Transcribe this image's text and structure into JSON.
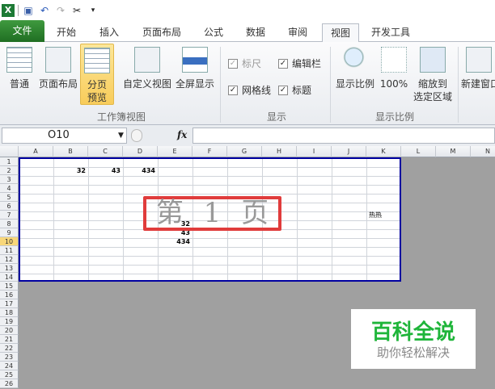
{
  "qat": {
    "icons": [
      "excel-logo-icon",
      "save-icon",
      "undo-icon",
      "redo-icon",
      "tools-icon",
      "customize-icon"
    ]
  },
  "tabs": [
    "文件",
    "开始",
    "插入",
    "页面布局",
    "公式",
    "数据",
    "审阅",
    "视图",
    "开发工具"
  ],
  "active_tab": "视图",
  "ribbon": {
    "workbook_views": {
      "label": "工作簿视图",
      "buttons": [
        "普通",
        "页面布局",
        "分页\n预览",
        "自定义视图",
        "全屏显示"
      ],
      "active": "分页预览"
    },
    "show": {
      "label": "显示",
      "checks": [
        {
          "label": "标尺",
          "checked": true,
          "disabled": true
        },
        {
          "label": "编辑栏",
          "checked": true
        },
        {
          "label": "网格线",
          "checked": true
        },
        {
          "label": "标题",
          "checked": true
        }
      ]
    },
    "zoom": {
      "label": "显示比例",
      "buttons": [
        "显示比例",
        "100%",
        "缩放到\n选定区域"
      ]
    },
    "window": {
      "buttons": [
        "新建窗口"
      ]
    }
  },
  "formula_bar": {
    "name_box": "O10",
    "fx": "fx",
    "formula": ""
  },
  "columns": [
    "A",
    "B",
    "C",
    "D",
    "E",
    "F",
    "G",
    "H",
    "I",
    "J",
    "K",
    "L",
    "M",
    "N"
  ],
  "rows": [
    "1",
    "2",
    "3",
    "4",
    "5",
    "6",
    "7",
    "8",
    "9",
    "10",
    "11",
    "12",
    "13",
    "14",
    "15",
    "16",
    "17",
    "18",
    "19",
    "20",
    "21",
    "22",
    "23",
    "24",
    "25",
    "26"
  ],
  "selected_row": "10",
  "cells": [
    {
      "ref": "B2",
      "value": "32"
    },
    {
      "ref": "C2",
      "value": "43"
    },
    {
      "ref": "D2",
      "value": "434"
    },
    {
      "ref": "E8",
      "value": "32"
    },
    {
      "ref": "E9",
      "value": "43"
    },
    {
      "ref": "E10",
      "value": "434"
    },
    {
      "ref": "K7",
      "value": "热热"
    }
  ],
  "page_label": "第 1 页",
  "watermark": {
    "title": "百科全说",
    "subtitle": "助你轻松解决",
    "color": "#1fb53a"
  }
}
